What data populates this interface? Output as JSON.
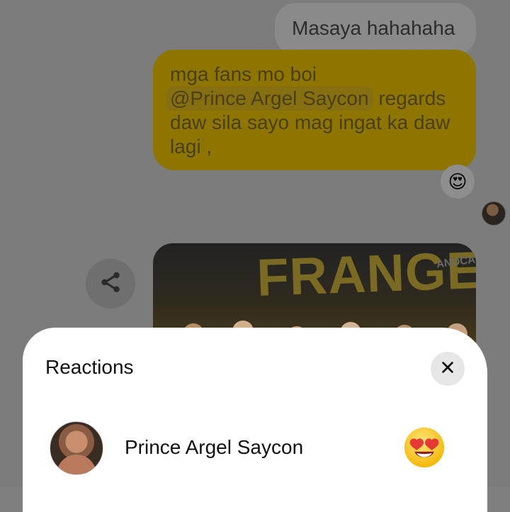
{
  "messages": {
    "outgoing_text_1": "Masaya hahahaha",
    "outgoing_text_2": {
      "before_mention": "mga fans mo boi",
      "mention": "@Prince Argel Saycon",
      "after_mention": "regards daw sila sayo mag ingat ka daw lagi ,"
    },
    "reaction_emoji": "😍",
    "photo": {
      "banner_text": "FRANGEL",
      "side_text": "ANOCA"
    }
  },
  "reactions_sheet": {
    "title": "Reactions",
    "items": [
      {
        "name": "Prince Argel Saycon",
        "emoji_name": "heart-eyes-emoji"
      }
    ]
  },
  "icons": {
    "share": "share-icon",
    "close": "close-icon",
    "reaction": "heart-eyes-emoji"
  },
  "colors": {
    "overlay": "#7c7c7c",
    "outgoing_bubble": "#8d7500",
    "sheet_bg": "#ffffff",
    "close_button_bg": "#e7e7e7"
  }
}
